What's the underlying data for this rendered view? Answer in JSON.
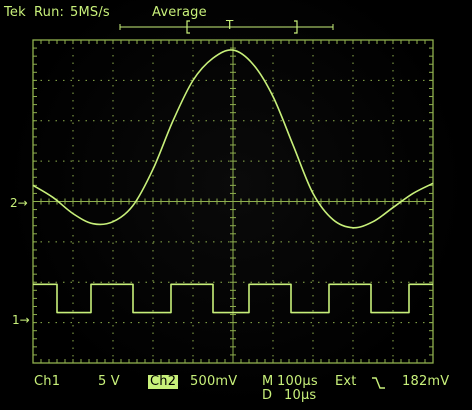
{
  "status_bar": {
    "brand": "Tek",
    "run_state": "Run:",
    "sample_rate": "5MS/s",
    "acq_mode": "Average",
    "trigger_marker": "T"
  },
  "channel_markers": {
    "ch2": "2",
    "ch1": "1"
  },
  "bottom_bar": {
    "ch1_label": "Ch1",
    "ch1_scale": "5 V",
    "ch2_label": "Ch2",
    "ch2_scale": "500mV",
    "main_prefix": "M",
    "main_timebase": "100µs",
    "delay_prefix": "D",
    "delay_timebase": "10µs",
    "trigger_source": "Ext",
    "trigger_slope_icon": "falling-edge-icon",
    "trigger_level": "182mV"
  },
  "display": {
    "divisions_x": 10,
    "divisions_y": 8,
    "trace_color": "#c8f07a",
    "grid_color": "#8fb04e"
  },
  "chart_data": {
    "type": "line",
    "title": "",
    "xlabel": "",
    "ylabel": "",
    "x_unit": "divisions",
    "xlim": [
      0,
      10
    ],
    "ylim": [
      -4,
      4
    ],
    "grid": true,
    "series": [
      {
        "name": "Ch2",
        "x": [
          0,
          0.5,
          1,
          1.5,
          2,
          2.5,
          3,
          3.5,
          4,
          4.5,
          5,
          5.5,
          6,
          6.5,
          7,
          7.5,
          8,
          8.5,
          9,
          9.5,
          10
        ],
        "y": [
          0.4,
          0.1,
          -0.3,
          -0.55,
          -0.5,
          -0.1,
          0.8,
          2.0,
          3.0,
          3.55,
          3.75,
          3.4,
          2.6,
          1.4,
          0.2,
          -0.45,
          -0.65,
          -0.5,
          -0.15,
          0.2,
          0.45
        ]
      },
      {
        "name": "Ch1",
        "x": [
          0,
          0.6,
          0.6,
          1.45,
          1.45,
          2.5,
          2.5,
          3.45,
          3.45,
          4.5,
          4.5,
          5.4,
          5.4,
          6.45,
          6.45,
          7.4,
          7.4,
          8.45,
          8.45,
          9.4,
          9.4,
          10
        ],
        "y": [
          -2.05,
          -2.05,
          -2.75,
          -2.75,
          -2.05,
          -2.05,
          -2.75,
          -2.75,
          -2.05,
          -2.05,
          -2.75,
          -2.75,
          -2.05,
          -2.05,
          -2.75,
          -2.75,
          -2.05,
          -2.05,
          -2.75,
          -2.75,
          -2.05,
          -2.05
        ]
      }
    ]
  }
}
